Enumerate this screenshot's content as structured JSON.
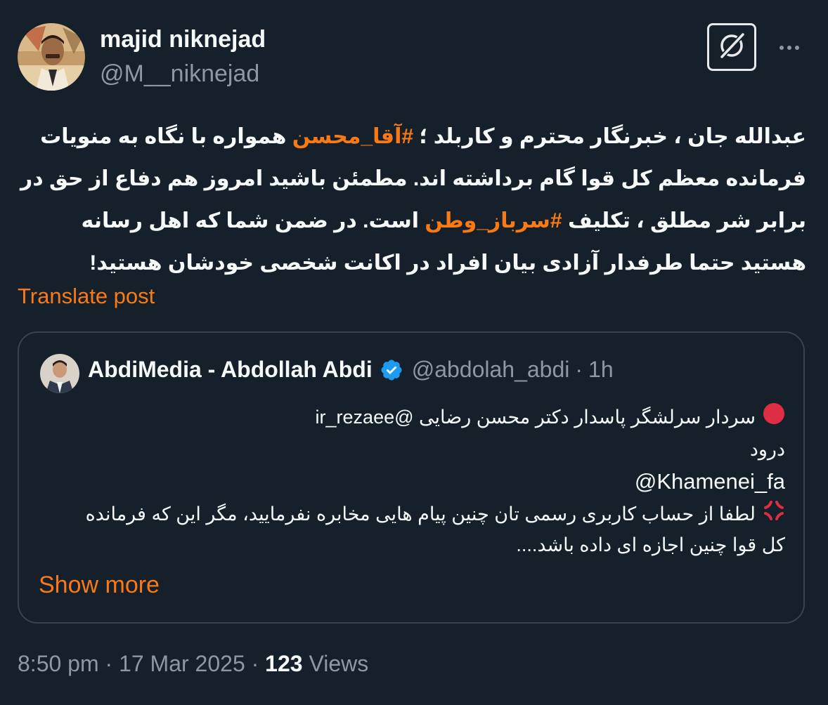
{
  "author": {
    "name": "majid niknejad",
    "handle": "@M__niknejad"
  },
  "post": {
    "text_parts": [
      "عبدالله جان ، خبرنگار محترم و کاربلد ؛ ",
      "#آقا_محسن",
      " همواره با نگاه به منویات فرمانده معظم کل قوا گام برداشته اند. مطمئن باشید امروز هم دفاع از حق در برابر شر مطلق ، تکلیف ",
      "#سرباز_وطن",
      " است. در ضمن شما که اهل رسانه هستید حتما طرفدار آزادی بیان افراد در اکانت شخصی خودشان هستید!"
    ],
    "translate_label": "Translate post"
  },
  "quote": {
    "name": "AbdiMedia - Abdollah Abdi",
    "handle": "@abdolah_abdi",
    "separator": "·",
    "time": "1h",
    "lines": [
      "سردار سرلشگر پاسدار دکتر محسن رضایی @ir_rezaee",
      "درود",
      "@Khamenei_fa",
      "لطفا از حساب کاربری رسمی تان چنین پیام هایی مخابره نفرمایید، مگر این که فرمانده",
      "کل قوا چنین اجازه ای داده باشد...."
    ],
    "show_more_label": "Show more"
  },
  "meta": {
    "time": "8:50 pm",
    "date": "17 Mar 2025",
    "separator": "·",
    "views_count": "123",
    "views_label": "Views"
  },
  "colors": {
    "background": "#15202b",
    "accent": "#f97a14",
    "secondary_text": "#8b98a5",
    "verified": "#1d9bf0"
  },
  "icons": {
    "grok": "grok-icon",
    "more": "more-icon",
    "verified": "verified-badge-icon",
    "red_circle": "red-circle-emoji",
    "anger": "anger-emoji"
  }
}
